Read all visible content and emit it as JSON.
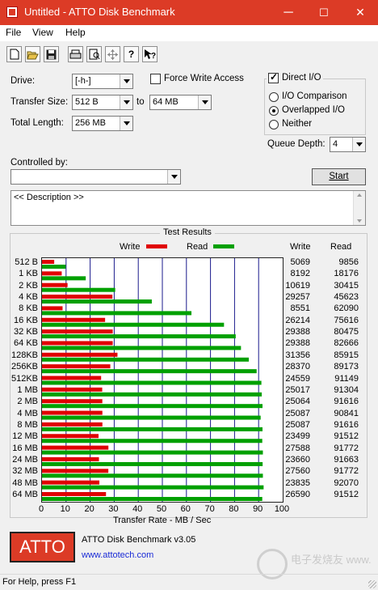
{
  "window": {
    "title": "Untitled - ATTO Disk Benchmark",
    "minimize": "─",
    "maximize": "☐",
    "close": "✕"
  },
  "menu": {
    "file": "File",
    "view": "View",
    "help": "Help"
  },
  "toolbar": {
    "icons": [
      "new-icon",
      "open-icon",
      "save-icon",
      "print-icon",
      "print-preview-icon",
      "move-icon",
      "help-icon",
      "context-help-icon"
    ]
  },
  "settings": {
    "drive_label": "Drive:",
    "drive_value": "[-h-]",
    "transfer_size_label": "Transfer Size:",
    "transfer_size_from": "512 B",
    "to_label": "to",
    "transfer_size_to": "64 MB",
    "total_length_label": "Total Length:",
    "total_length_value": "256 MB",
    "force_write_label": "Force Write Access",
    "force_write_checked": false,
    "direct_io_label": "Direct I/O",
    "direct_io_checked": true,
    "io_comparison_label": "I/O Comparison",
    "overlapped_io_label": "Overlapped I/O",
    "neither_label": "Neither",
    "io_mode_selected": "Overlapped I/O",
    "queue_depth_label": "Queue Depth:",
    "queue_depth_value": "4",
    "controlled_by_label": "Controlled by:",
    "controlled_by_value": "",
    "start_button": "Start",
    "description_text": "<< Description >>"
  },
  "results": {
    "group_title": "Test Results",
    "legend_write": "Write",
    "legend_read": "Read",
    "col_write": "Write",
    "col_read": "Read",
    "write_color": "#e00000",
    "read_color": "#00a000"
  },
  "chart_data": {
    "type": "bar",
    "orientation": "horizontal",
    "categories": [
      "512 B",
      "1 KB",
      "2 KB",
      "4 KB",
      "8 KB",
      "16 KB",
      "32 KB",
      "64 KB",
      "128KB",
      "256KB",
      "512KB",
      "1 MB",
      "2 MB",
      "4 MB",
      "8 MB",
      "12 MB",
      "16 MB",
      "24 MB",
      "32 MB",
      "48 MB",
      "64 MB"
    ],
    "series": [
      {
        "name": "Write",
        "values": [
          5069,
          8192,
          10619,
          29257,
          8551,
          26214,
          29388,
          29388,
          31356,
          28370,
          24559,
          25017,
          25064,
          25087,
          25087,
          23499,
          27588,
          23660,
          27560,
          23835,
          26590
        ]
      },
      {
        "name": "Read",
        "values": [
          9856,
          18176,
          30415,
          45623,
          62090,
          75616,
          80475,
          82666,
          85915,
          89173,
          91149,
          91304,
          91616,
          90841,
          91616,
          91512,
          91772,
          91663,
          91772,
          92070,
          91512
        ]
      }
    ],
    "xlabel": "Transfer Rate - MB / Sec",
    "xlim": [
      0,
      100
    ],
    "xticks": [
      "0",
      "10",
      "20",
      "30",
      "40",
      "50",
      "60",
      "70",
      "80",
      "90",
      "100"
    ],
    "grid": true,
    "legend": "top"
  },
  "footer": {
    "logo_text": "ATTO",
    "product_name": "ATTO Disk Benchmark v3.05",
    "url": "www.attotech.com",
    "watermark": "电子发烧友 www.elecfans.com"
  },
  "status": {
    "text": "For Help, press F1"
  }
}
